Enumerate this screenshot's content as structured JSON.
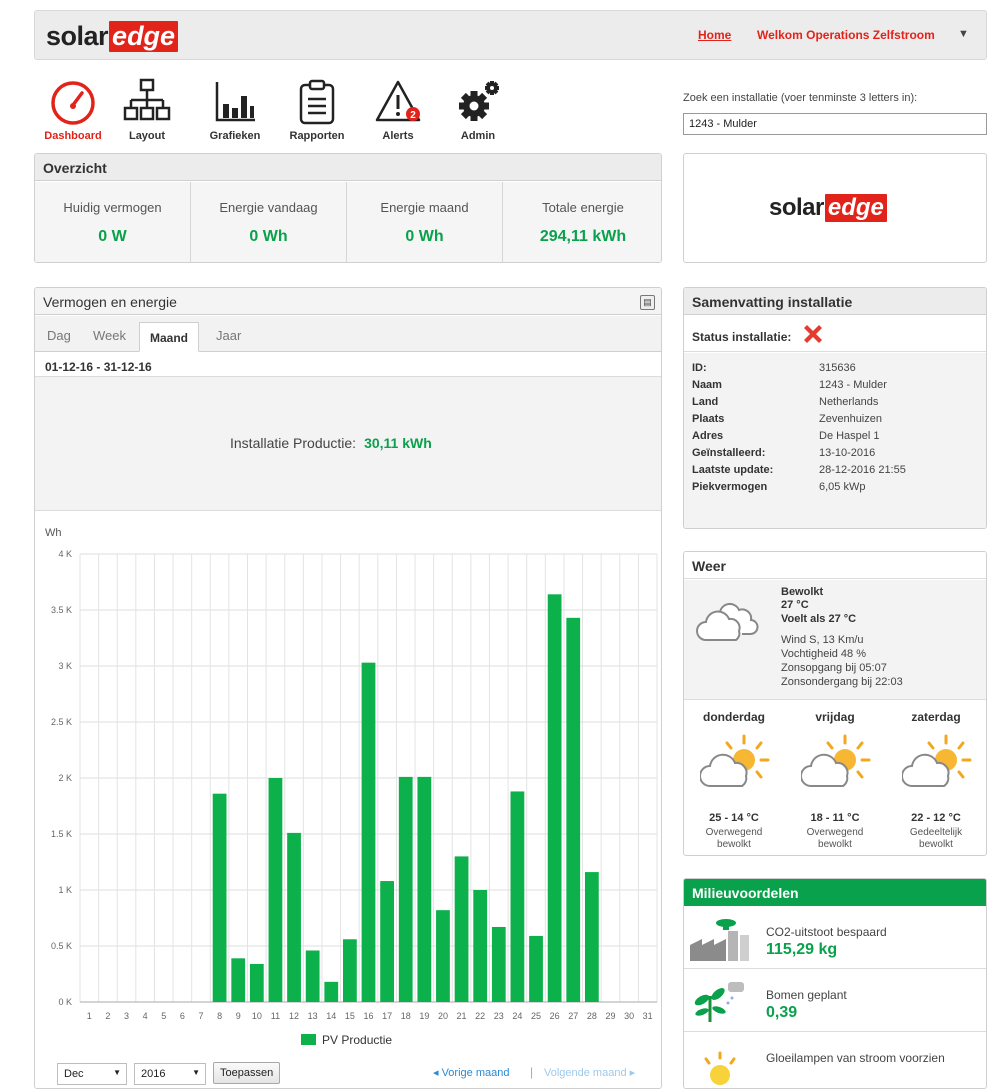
{
  "header": {
    "logo_solar": "solar",
    "logo_edge": "edge",
    "home": "Home",
    "welcome": "Welkom Operations Zelfstroom",
    "caret": "▼"
  },
  "nav": [
    {
      "label": "Dashboard",
      "icon": "dashboard-gauge-icon"
    },
    {
      "label": "Layout",
      "icon": "layout-tree-icon"
    },
    {
      "label": "Grafieken",
      "icon": "bar-chart-icon"
    },
    {
      "label": "Rapporten",
      "icon": "clipboard-report-icon"
    },
    {
      "label": "Alerts",
      "icon": "warning-triangle-icon",
      "badge": "2"
    },
    {
      "label": "Admin",
      "icon": "gears-icon"
    }
  ],
  "search": {
    "label": "Zoek een installatie (voer tenminste 3 letters in):",
    "value": "1243 - Mulder"
  },
  "overview": {
    "title": "Overzicht",
    "cells": [
      {
        "label": "Huidig vermogen",
        "value": "0 W"
      },
      {
        "label": "Energie vandaag",
        "value": "0 Wh"
      },
      {
        "label": "Energie maand",
        "value": "0 Wh"
      },
      {
        "label": "Totale energie",
        "value": "294,11 kWh"
      }
    ]
  },
  "energy": {
    "title": "Vermogen en energie",
    "tabs": [
      "Dag",
      "Week",
      "Maand",
      "Jaar"
    ],
    "active_tab": "Maand",
    "range": "01-12-16 - 31-12-16",
    "production_label": "Installatie Productie:",
    "production_value": "30,11 kWh",
    "month_select": "Dec",
    "year_select": "2016",
    "apply": "Toepassen",
    "prev": "◂ Vorige maand",
    "separator": "|",
    "next": "Volgende maand ▸"
  },
  "chart_data": {
    "type": "bar",
    "ylabel": "Wh",
    "ylim": [
      0,
      4000
    ],
    "ytick_labels": [
      "0 K",
      "0.5 K",
      "1 K",
      "1.5 K",
      "2 K",
      "2.5 K",
      "3 K",
      "3.5 K",
      "4 K"
    ],
    "categories": [
      "1",
      "2",
      "3",
      "4",
      "5",
      "6",
      "7",
      "8",
      "9",
      "10",
      "11",
      "12",
      "13",
      "14",
      "15",
      "16",
      "17",
      "18",
      "19",
      "20",
      "21",
      "22",
      "23",
      "24",
      "25",
      "26",
      "27",
      "28",
      "29",
      "30",
      "31"
    ],
    "series": [
      {
        "name": "PV Productie",
        "color": "#0db14b",
        "values": [
          0,
          0,
          0,
          0,
          0,
          0,
          0,
          1860,
          390,
          340,
          2000,
          1510,
          460,
          180,
          560,
          3030,
          1080,
          2010,
          2010,
          820,
          1300,
          1000,
          670,
          1880,
          590,
          3640,
          3430,
          1160,
          0,
          0,
          0
        ]
      }
    ],
    "grid": true,
    "legend": "bottom-center"
  },
  "summary": {
    "title": "Samenvatting installatie",
    "status_label": "Status installatie:",
    "status_icon": "red-x-icon",
    "rows": [
      {
        "k": "ID:",
        "v": "315636"
      },
      {
        "k": "Naam",
        "v": "1243 - Mulder"
      },
      {
        "k": "Land",
        "v": "Netherlands"
      },
      {
        "k": "Plaats",
        "v": "Zevenhuizen"
      },
      {
        "k": "Adres",
        "v": "De Haspel 1"
      },
      {
        "k": "Geïnstalleerd:",
        "v": "13-10-2016"
      },
      {
        "k": "Laatste update:",
        "v": "28-12-2016 21:55"
      },
      {
        "k": "Piekvermogen",
        "v": "6,05 kWp"
      }
    ]
  },
  "weather": {
    "title": "Weer",
    "now": {
      "cond": "Bewolkt",
      "temp": "27 °C",
      "feels": "Voelt als 27 °C",
      "wind": "Wind S, 13 Km/u",
      "humidity": "Vochtigheid 48 %",
      "sunrise": "Zonsopgang bij 05:07",
      "sunset": "Zonsondergang bij 22:03"
    },
    "forecast": [
      {
        "day": "donderdag",
        "temp": "25 - 14 °C",
        "desc1": "Overwegend",
        "desc2": "bewolkt"
      },
      {
        "day": "vrijdag",
        "temp": "18 - 11 °C",
        "desc1": "Overwegend",
        "desc2": "bewolkt"
      },
      {
        "day": "zaterdag",
        "temp": "22 - 12 °C",
        "desc1": "Gedeeltelijk",
        "desc2": "bewolkt"
      }
    ]
  },
  "env": {
    "title": "Milieuvoordelen",
    "rows": [
      {
        "label": "CO2-uitstoot bespaard",
        "value": "115,29 kg"
      },
      {
        "label": "Bomen geplant",
        "value": "0,39"
      },
      {
        "label": "Gloeilampen van stroom voorzien",
        "value": ""
      }
    ]
  }
}
